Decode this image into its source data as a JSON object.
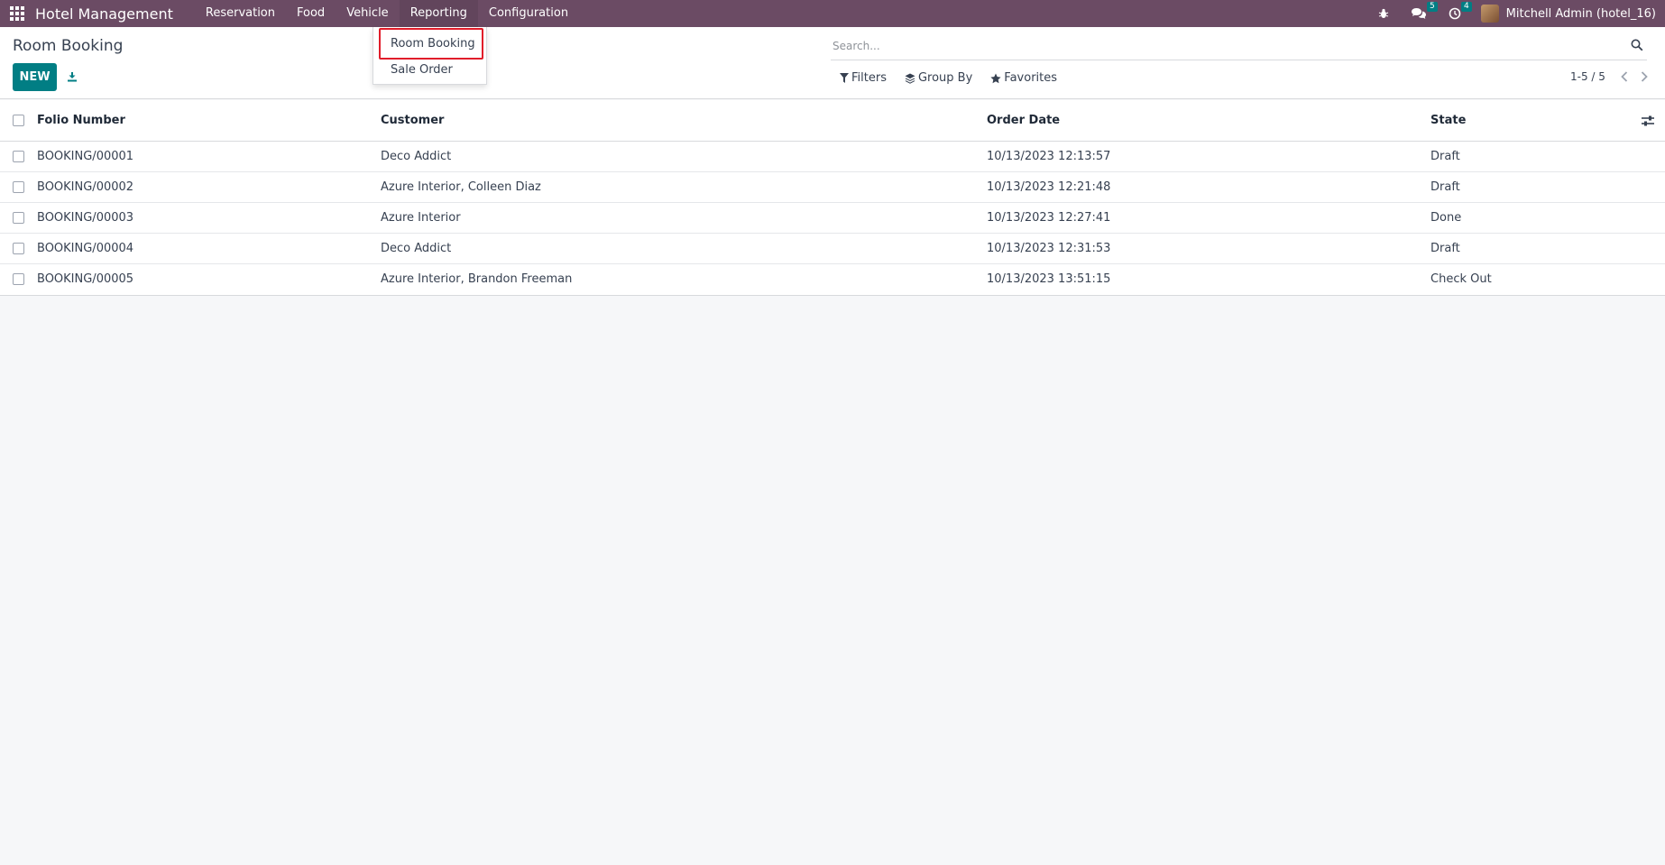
{
  "navbar": {
    "brand": "Hotel Management",
    "menu": [
      "Reservation",
      "Food",
      "Vehicle",
      "Reporting",
      "Configuration"
    ],
    "messages_count": "5",
    "activities_count": "4",
    "user": "Mitchell Admin (hotel_16)"
  },
  "dropdown": {
    "items": [
      "Room Booking",
      "Sale Order"
    ]
  },
  "control": {
    "title": "Room Booking",
    "new_label": "NEW",
    "search_placeholder": "Search...",
    "filters_label": "Filters",
    "groupby_label": "Group By",
    "favorites_label": "Favorites",
    "pager": "1-5 / 5"
  },
  "table": {
    "columns": [
      "Folio Number",
      "Customer",
      "Order Date",
      "State"
    ],
    "rows": [
      {
        "folio": "BOOKING/00001",
        "customer": "Deco Addict",
        "date": "10/13/2023 12:13:57",
        "state": "Draft"
      },
      {
        "folio": "BOOKING/00002",
        "customer": "Azure Interior, Colleen Diaz",
        "date": "10/13/2023 12:21:48",
        "state": "Draft"
      },
      {
        "folio": "BOOKING/00003",
        "customer": "Azure Interior",
        "date": "10/13/2023 12:27:41",
        "state": "Done"
      },
      {
        "folio": "BOOKING/00004",
        "customer": "Deco Addict",
        "date": "10/13/2023 12:31:53",
        "state": "Draft"
      },
      {
        "folio": "BOOKING/00005",
        "customer": "Azure Interior, Brandon Freeman",
        "date": "10/13/2023 13:51:15",
        "state": "Check Out"
      }
    ]
  },
  "colors": {
    "navbar": "#6b4b64",
    "primary": "#017e84",
    "highlight": "#e11d2a"
  }
}
